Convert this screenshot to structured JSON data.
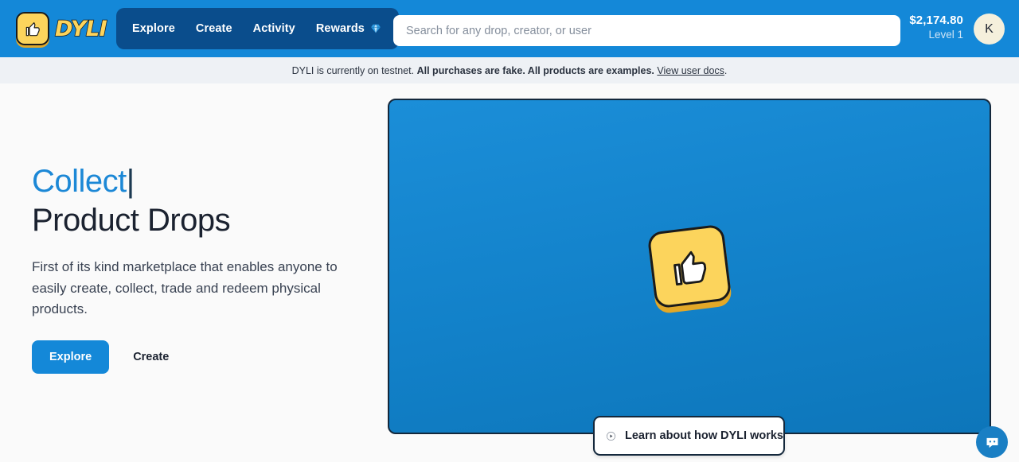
{
  "header": {
    "logo": {
      "icon": "thumbs-up-icon",
      "wordmark": "DYLI"
    },
    "nav": [
      {
        "label": "Explore",
        "icon": null
      },
      {
        "label": "Create",
        "icon": null
      },
      {
        "label": "Activity",
        "icon": null
      },
      {
        "label": "Rewards",
        "icon": "gem-icon"
      }
    ],
    "search": {
      "value": "",
      "placeholder": "Search for any drop, creator, or user",
      "icon": "search-icon"
    },
    "wallet": {
      "balance": "$2,174.80",
      "level": "Level 1"
    },
    "avatar": {
      "initial": "K"
    },
    "colors": {
      "header_bg": "#1488d8",
      "nav_pill_bg": "#0a4d8c",
      "accent": "#1c88d6",
      "logo_yellow": "#fcd45c"
    }
  },
  "banner": {
    "text_plain": "DYLI is currently on testnet.",
    "text_bold": "All purchases are fake. All products are examples.",
    "link": "View user docs",
    "trailing": "."
  },
  "hero": {
    "headline_animated": "Collect",
    "headline_caret": "|",
    "headline_static": "Product Drops",
    "subtitle": "First of its kind marketplace that enables anyone to easily create, collect, trade and redeem physical products.",
    "buttons": [
      {
        "label": "Explore",
        "style": "primary"
      },
      {
        "label": "Create",
        "style": "ghost"
      }
    ]
  },
  "hero_media": {
    "type": "video-card",
    "logo_icon": "thumbs-up-icon",
    "cta": {
      "label": "Learn about how DYLI works",
      "icon": "play-circle-icon"
    },
    "bg_color": "#1281c9"
  },
  "chat": {
    "icon": "chat-bubble-icon",
    "color": "#1a7fc4"
  }
}
